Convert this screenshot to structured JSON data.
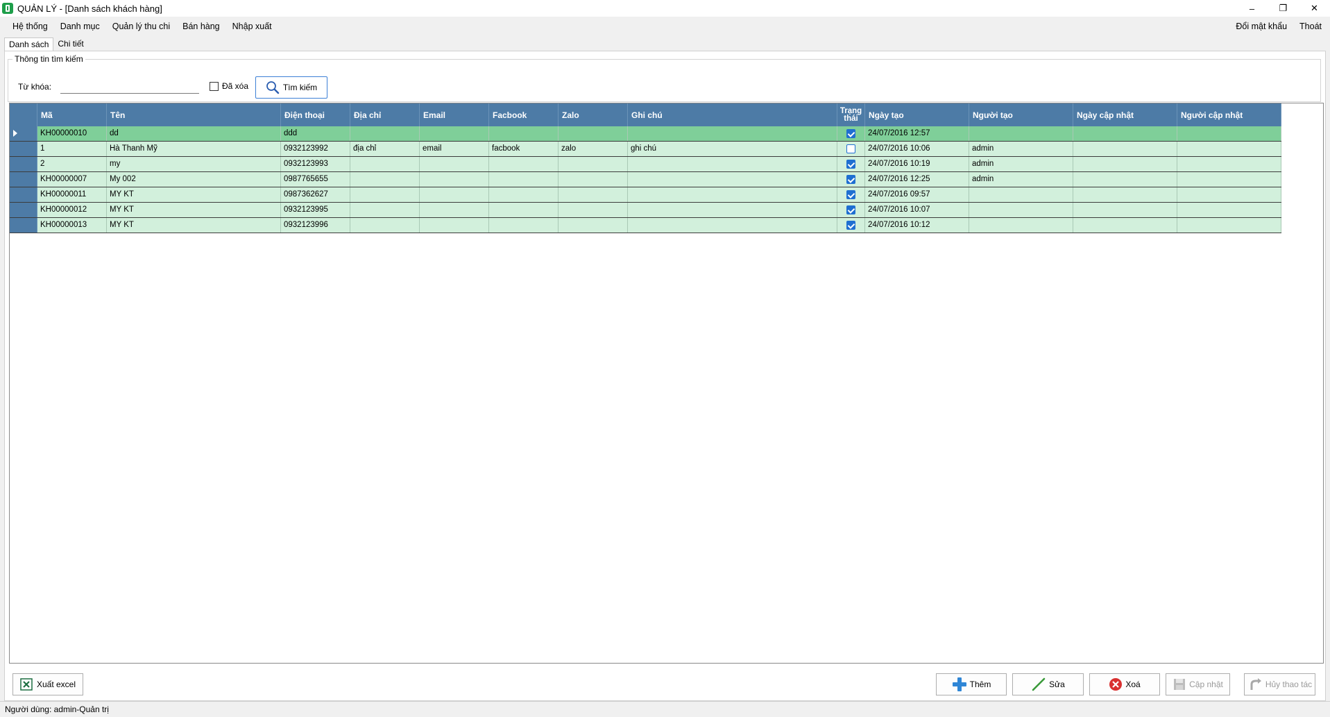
{
  "window": {
    "title": "QUẢN LÝ - [Danh sách khách hàng]",
    "minimize_glyph": "–",
    "restore_glyph": "❐",
    "close_glyph": "✕"
  },
  "menu": {
    "items": [
      "Hệ thống",
      "Danh mục",
      "Quản lý thu chi",
      "Bán hàng",
      "Nhập xuất"
    ],
    "right": [
      "Đổi mật khẩu",
      "Thoát"
    ]
  },
  "tabs": [
    {
      "label": "Danh sách",
      "active": true
    },
    {
      "label": "Chi tiết",
      "active": false
    }
  ],
  "search": {
    "group_label": "Thông tin tìm kiếm",
    "keyword_label": "Từ khóa:",
    "keyword_value": "",
    "keyword_placeholder": "",
    "deleted_label": "Đã xóa",
    "deleted_checked": false,
    "button_label": "Tìm kiếm"
  },
  "grid": {
    "columns": [
      "Mã",
      "Tên",
      "Điện thoại",
      "Địa chỉ",
      "Email",
      "Facbook",
      "Zalo",
      "Ghi chú",
      "Trạng thái",
      "Ngày tạo",
      "Người tạo",
      "Ngày cập nhật",
      "Người cập nhật"
    ],
    "status_header_lines": [
      "Trạng",
      "thái"
    ],
    "rows": [
      {
        "ma": "KH00000010",
        "ten": "dd",
        "dien_thoai": "ddd",
        "dia_chi": "",
        "email": "",
        "facebook": "",
        "zalo": "",
        "ghi_chu": "",
        "trang_thai": true,
        "ngay_tao": "24/07/2016 12:57",
        "nguoi_tao": "",
        "ngay_cap_nhat": "",
        "nguoi_cap_nhat": "",
        "selected": true
      },
      {
        "ma": "1",
        "ten": "Hà Thanh Mỹ",
        "dien_thoai": "0932123992",
        "dia_chi": "địa chỉ",
        "email": "email",
        "facebook": "facbook",
        "zalo": "zalo",
        "ghi_chu": "ghi chú",
        "trang_thai": false,
        "ngay_tao": "24/07/2016 10:06",
        "nguoi_tao": "admin",
        "ngay_cap_nhat": "",
        "nguoi_cap_nhat": "",
        "selected": false
      },
      {
        "ma": "2",
        "ten": "my",
        "dien_thoai": "0932123993",
        "dia_chi": "",
        "email": "",
        "facebook": "",
        "zalo": "",
        "ghi_chu": "",
        "trang_thai": true,
        "ngay_tao": "24/07/2016 10:19",
        "nguoi_tao": "admin",
        "ngay_cap_nhat": "",
        "nguoi_cap_nhat": "",
        "selected": false
      },
      {
        "ma": "KH00000007",
        "ten": "My 002",
        "dien_thoai": "0987765655",
        "dia_chi": "",
        "email": "",
        "facebook": "",
        "zalo": "",
        "ghi_chu": "",
        "trang_thai": true,
        "ngay_tao": "24/07/2016 12:25",
        "nguoi_tao": "admin",
        "ngay_cap_nhat": "",
        "nguoi_cap_nhat": "",
        "selected": false
      },
      {
        "ma": "KH00000011",
        "ten": "MY KT",
        "dien_thoai": "0987362627",
        "dia_chi": "",
        "email": "",
        "facebook": "",
        "zalo": "",
        "ghi_chu": "",
        "trang_thai": true,
        "ngay_tao": "24/07/2016 09:57",
        "nguoi_tao": "",
        "ngay_cap_nhat": "",
        "nguoi_cap_nhat": "",
        "selected": false
      },
      {
        "ma": "KH00000012",
        "ten": "MY KT",
        "dien_thoai": "0932123995",
        "dia_chi": "",
        "email": "",
        "facebook": "",
        "zalo": "",
        "ghi_chu": "",
        "trang_thai": true,
        "ngay_tao": "24/07/2016 10:07",
        "nguoi_tao": "",
        "ngay_cap_nhat": "",
        "nguoi_cap_nhat": "",
        "selected": false
      },
      {
        "ma": "KH00000013",
        "ten": "MY KT",
        "dien_thoai": "0932123996",
        "dia_chi": "",
        "email": "",
        "facebook": "",
        "zalo": "",
        "ghi_chu": "",
        "trang_thai": true,
        "ngay_tao": "24/07/2016 10:12",
        "nguoi_tao": "",
        "ngay_cap_nhat": "",
        "nguoi_cap_nhat": "",
        "selected": false
      }
    ]
  },
  "buttons": {
    "export_excel": "Xuất excel",
    "add": "Thêm",
    "edit": "Sửa",
    "delete": "Xoá",
    "update": "Cập nhật",
    "cancel": "Hủy thao tác"
  },
  "status_bar": {
    "text": "Người dùng: admin-Quản trị"
  },
  "colors": {
    "header": "#4d7ba6",
    "row": "#d2f0dc",
    "selected_row": "#7fcf99",
    "checkbox": "#1f6fd1"
  }
}
